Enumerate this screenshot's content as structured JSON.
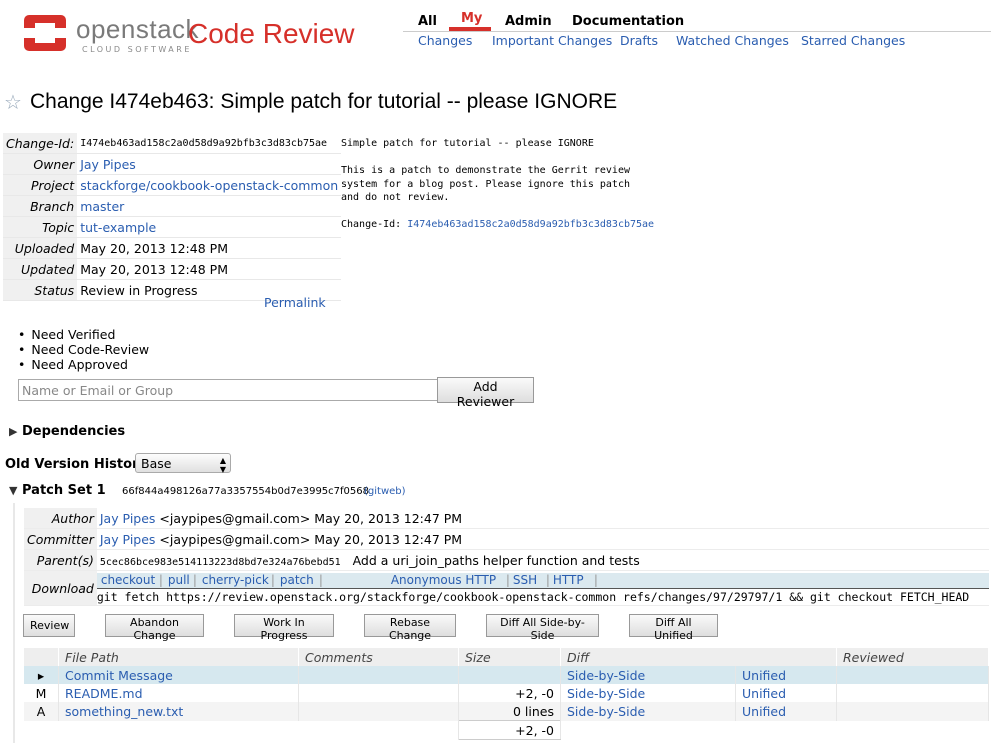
{
  "header": {
    "logo_word": "openstack",
    "logo_sub": "CLOUD SOFTWARE",
    "app_title": "Code Review",
    "nav": [
      "All",
      "My",
      "Admin",
      "Documentation"
    ],
    "sub_nav": [
      "Changes",
      "Important Changes",
      "Drafts",
      "Watched Changes",
      "Starred Changes"
    ],
    "accent_color": "#d6302a"
  },
  "title": "Change I474eb463: Simple patch for tutorial -- please IGNORE",
  "info": [
    {
      "key": "Change-Id:",
      "value": "I474eb463ad158c2a0d58d9a92bfb3c3d83cb75ae"
    },
    {
      "key": "Owner",
      "value": "Jay Pipes"
    },
    {
      "key": "Project",
      "value": "stackforge/cookbook-openstack-common"
    },
    {
      "key": "Branch",
      "value": "master"
    },
    {
      "key": "Topic",
      "value": "tut-example"
    },
    {
      "key": "Uploaded",
      "value": "May 20, 2013 12:48 PM"
    },
    {
      "key": "Updated",
      "value": "May 20, 2013 12:48 PM"
    },
    {
      "key": "Status",
      "value": "Review in Progress"
    }
  ],
  "permalink": "Permalink",
  "message": {
    "body": "Simple patch for tutorial -- please IGNORE\n\nThis is a patch to demonstrate the Gerrit review\nsystem for a blog post. Please ignore this patch\nand do not review.\n\n",
    "changeid_label": "Change-Id: ",
    "changeid_value": "I474eb463ad158c2a0d58d9a92bfb3c3d83cb75ae"
  },
  "needs": [
    "Need Verified",
    "Need Code-Review",
    "Need Approved"
  ],
  "reviewer": {
    "placeholder": "Name or Email or Group",
    "button": "Add Reviewer"
  },
  "dependencies": "Dependencies",
  "old_version": {
    "label": "Old Version History:",
    "selected": "Base"
  },
  "patch_set": {
    "label": "Patch Set 1",
    "hash": "66f844a498126a77a3357554b0d7e3995c7f0568",
    "gitweb": "(gitweb)",
    "author_key": "Author",
    "author_name": "Jay Pipes",
    "author_rest": " <jaypipes@gmail.com> May 20, 2013 12:47 PM",
    "committer_key": "Committer",
    "committer_name": "Jay Pipes",
    "committer_rest": " <jaypipes@gmail.com> May 20, 2013 12:47 PM",
    "parent_key": "Parent(s)",
    "parent_hash": "5cec86bce983e514113223d8bd7e324a76bebd51",
    "parent_msg": "Add a uri_join_paths helper function and tests",
    "download_key": "Download",
    "download_tabs": [
      "checkout",
      "pull",
      "cherry-pick",
      "patch"
    ],
    "download_protocols": [
      "Anonymous HTTP",
      "SSH",
      "HTTP"
    ],
    "download_cmd": "git fetch https://review.openstack.org/stackforge/cookbook-openstack-common refs/changes/97/29797/1 && git checkout FETCH_HEAD"
  },
  "actions": [
    "Review",
    "Abandon Change",
    "Work In Progress",
    "Rebase Change",
    "Diff All Side-by-Side",
    "Diff All Unified"
  ],
  "files": {
    "headers": [
      "File Path",
      "Comments",
      "Size",
      "Diff",
      "Reviewed"
    ],
    "rows": [
      {
        "status": "",
        "path": "Commit Message",
        "size": "",
        "sbs": "Side-by-Side",
        "unified": "Unified"
      },
      {
        "status": "M",
        "path": "README.md",
        "size": "+2, -0",
        "sbs": "Side-by-Side",
        "unified": "Unified"
      },
      {
        "status": "A",
        "path": "something_new.txt",
        "size": "0 lines",
        "sbs": "Side-by-Side",
        "unified": "Unified"
      }
    ],
    "total": "+2, -0"
  }
}
